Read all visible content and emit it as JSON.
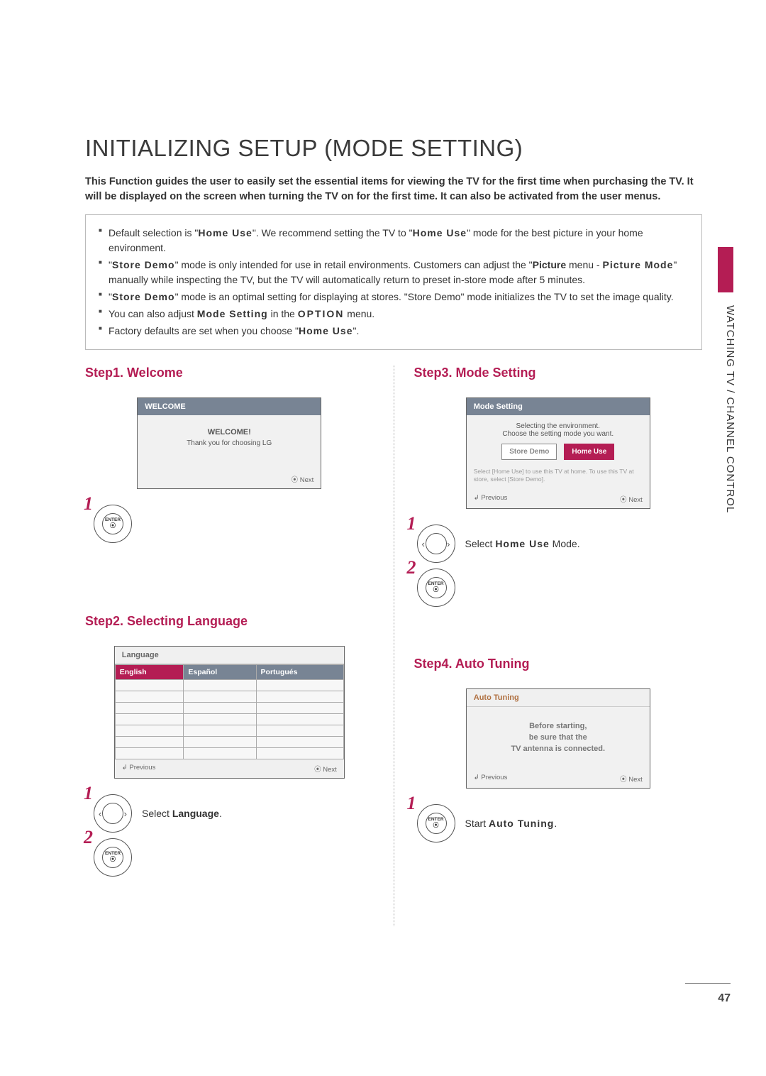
{
  "page": {
    "number": "47",
    "section_tab": "WATCHING TV / CHANNEL CONTROL"
  },
  "title": "INITIALIZING SETUP (MODE SETTING)",
  "intro": "This Function guides the user to easily set the essential items for viewing the TV for the first time when purchasing the TV. It will be displayed on the screen when turning the TV on for the first time. It can also be activated from the user menus.",
  "notes": {
    "n1_a": "Default selection is \"",
    "n1_b": "Home Use",
    "n1_c": "\". We recommend setting the TV to \"",
    "n1_d": "Home Use",
    "n1_e": "\" mode for the best picture in your home environment.",
    "n2_a": "\"",
    "n2_b": "Store Demo",
    "n2_c": "\" mode is only intended for use in retail environments. Customers can adjust the \"",
    "n2_d": "Picture",
    "n2_e": " menu - ",
    "n2_f": "Picture Mode",
    "n2_g": "\" manually while inspecting the TV, but the TV will automatically return to preset in-store mode after 5 minutes.",
    "n3_a": "\"",
    "n3_b": "Store Demo",
    "n3_c": "\" mode is an optimal setting for displaying at stores. \"Store Demo\" mode initializes the TV to set the image quality.",
    "n4_a": "You can also adjust ",
    "n4_b": "Mode Setting",
    "n4_c": " in the ",
    "n4_d": "OPTION",
    "n4_e": " menu.",
    "n5_a": "Factory defaults are set when you choose \"",
    "n5_b": "Home Use",
    "n5_c": "\"."
  },
  "steps": {
    "s1": {
      "title": "Step1. Welcome",
      "osd_title": "WELCOME",
      "osd_big": "WELCOME!",
      "osd_msg": "Thank you for choosing LG",
      "next": "Next",
      "btn_label": "ENTER"
    },
    "s2": {
      "title": "Step2. Selecting Language",
      "osd_title": "Language",
      "cols": [
        "English",
        "Español",
        "Portugués"
      ],
      "prev": "Previous",
      "next": "Next",
      "btn_label": "ENTER",
      "action_a": "Select ",
      "action_b": "Language",
      "action_c": "."
    },
    "s3": {
      "title": "Step3. Mode Setting",
      "osd_title": "Mode Setting",
      "osd_line1": "Selecting the environment.",
      "osd_line2": "Choose the setting mode you want.",
      "opt1": "Store Demo",
      "opt2": "Home Use",
      "tiny": "Select [Home Use] to use this TV at home. To use this TV at store, select [Store Demo].",
      "prev": "Previous",
      "next": "Next",
      "btn_label": "ENTER",
      "action_a": "Select ",
      "action_b": "Home Use",
      "action_c": " Mode."
    },
    "s4": {
      "title": "Step4. Auto Tuning",
      "osd_title": "Auto Tuning",
      "l1": "Before starting,",
      "l2": "be sure that the",
      "l3": "TV antenna is connected.",
      "prev": "Previous",
      "next": "Next",
      "btn_label": "ENTER",
      "action_a": "Start ",
      "action_b": "Auto Tuning",
      "action_c": "."
    }
  },
  "nums": {
    "one": "1",
    "two": "2"
  }
}
